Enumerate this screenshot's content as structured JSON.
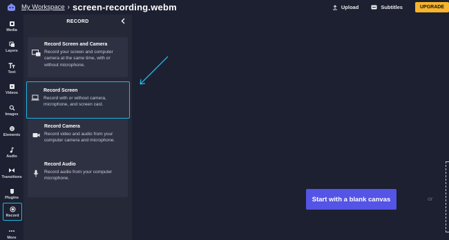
{
  "header": {
    "workspace_label": "My Workspace",
    "separator": "›",
    "file_name": "screen-recording.webm",
    "upload_label": "Upload",
    "subtitles_label": "Subtitles",
    "upgrade_label": "UPGRADE"
  },
  "rail": {
    "items": [
      {
        "label": "Media",
        "icon": "media-icon"
      },
      {
        "label": "Layers",
        "icon": "layers-icon"
      },
      {
        "label": "Text",
        "icon": "text-icon"
      },
      {
        "label": "Videos",
        "icon": "videos-icon"
      },
      {
        "label": "Images",
        "icon": "images-icon"
      },
      {
        "label": "Elements",
        "icon": "elements-icon"
      },
      {
        "label": "Audio",
        "icon": "audio-icon"
      },
      {
        "label": "Transitions",
        "icon": "transitions-icon"
      },
      {
        "label": "Plugins",
        "icon": "plugins-icon"
      },
      {
        "label": "Record",
        "icon": "record-icon",
        "active": true
      },
      {
        "label": "More",
        "icon": "more-icon"
      }
    ]
  },
  "panel": {
    "title": "RECORD",
    "cards": [
      {
        "title": "Record Screen and Camera",
        "description": "Record your screen and computer camera at the same time, with or without microphone.",
        "icon": "screen-camera-icon"
      },
      {
        "title": "Record Screen",
        "description": "Record with or without camera, microphone, and screen cast.",
        "icon": "laptop-icon",
        "highlighted": true
      },
      {
        "title": "Record Camera",
        "description": "Record video and audio from your computer camera and microphone.",
        "icon": "camera-icon"
      },
      {
        "title": "Record Audio",
        "description": "Record audio from your computer microphone.",
        "icon": "microphone-icon"
      }
    ]
  },
  "canvas": {
    "blank_canvas_label": "Start with a blank canvas",
    "or_label": "or"
  },
  "colors": {
    "background": "#1c2030",
    "panel": "#242837",
    "card": "#2d3142",
    "highlight": "#22b8e8",
    "primary_button": "#5454e6",
    "upgrade": "#f6b52c"
  }
}
